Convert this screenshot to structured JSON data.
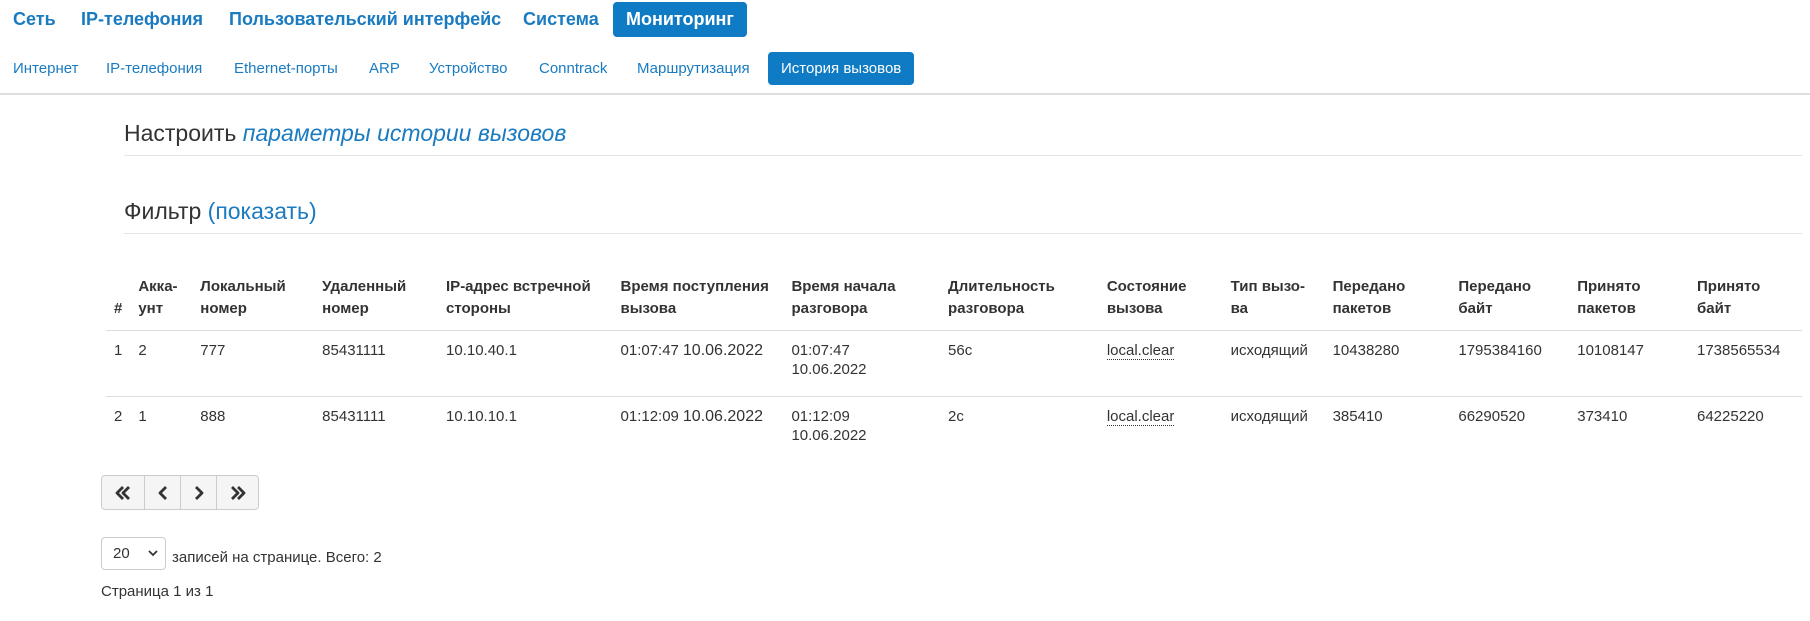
{
  "top_nav": [
    {
      "label": "Сеть",
      "active": false
    },
    {
      "label": "IP-телефония",
      "active": false
    },
    {
      "label": "Пользовательский интерфейс",
      "active": false
    },
    {
      "label": "Система",
      "active": false
    },
    {
      "label": "Мониторинг",
      "active": true
    }
  ],
  "sub_nav": [
    {
      "label": "Интернет",
      "active": false
    },
    {
      "label": "IP-телефония",
      "active": false
    },
    {
      "label": "Ethernet-порты",
      "active": false
    },
    {
      "label": "ARP",
      "active": false
    },
    {
      "label": "Устройство",
      "active": false
    },
    {
      "label": "Conntrack",
      "active": false
    },
    {
      "label": "Маршрутизация",
      "active": false
    },
    {
      "label": "История вызовов",
      "active": true
    }
  ],
  "settings": {
    "prefix": "Настроить",
    "link": "параметры истории вызовов"
  },
  "filter": {
    "title": "Фильтр",
    "toggle": "(показать)"
  },
  "table": {
    "headers": [
      [
        "#"
      ],
      [
        "Акка-",
        "унт"
      ],
      [
        "Локальный",
        "номер"
      ],
      [
        "Удаленный",
        "номер"
      ],
      [
        "IP-адрес встречной",
        "стороны"
      ],
      [
        "Время поступления",
        "вызова"
      ],
      [
        "Время начала",
        "разговора"
      ],
      [
        "Длительность",
        "разговора"
      ],
      [
        "Состояние",
        "вызова"
      ],
      [
        "Тип вызо-",
        "ва"
      ],
      [
        "Передано",
        "пакетов"
      ],
      [
        "Передано",
        "байт"
      ],
      [
        "Принято",
        "пакетов"
      ],
      [
        "Принято",
        "байт"
      ]
    ],
    "rows": [
      {
        "n": "1",
        "account": "2",
        "local": "777",
        "remote": "85431111",
        "ip": "10.10.40.1",
        "arrival_time": "01:07:47",
        "arrival_date": "10.06.2022",
        "start_time": "01:07:47",
        "start_date": "10.06.2022",
        "duration": "56с",
        "state": "local.clear",
        "type": "исходящий",
        "tx_packets": "10438280",
        "tx_bytes": "1795384160",
        "rx_packets": "10108147",
        "rx_bytes": "1738565534"
      },
      {
        "n": "2",
        "account": "1",
        "local": "888",
        "remote": "85431111",
        "ip": "10.10.10.1",
        "arrival_time": "01:12:09",
        "arrival_date": "10.06.2022",
        "start_time": "01:12:09",
        "start_date": "10.06.2022",
        "duration": "2с",
        "state": "local.clear",
        "type": "исходящий",
        "tx_packets": "385410",
        "tx_bytes": "66290520",
        "rx_packets": "373410",
        "rx_bytes": "64225220"
      }
    ]
  },
  "pager": {
    "buttons": [
      "first-page-icon",
      "prev-page-icon",
      "next-page-icon",
      "last-page-icon"
    ]
  },
  "per_page": {
    "value": "20",
    "text": "записей на странице. Всего: 2"
  },
  "page_info": "Страница 1 из 1",
  "colors": {
    "accent": "#0f7bc4",
    "link": "#1a7bc1",
    "text": "#333333"
  }
}
